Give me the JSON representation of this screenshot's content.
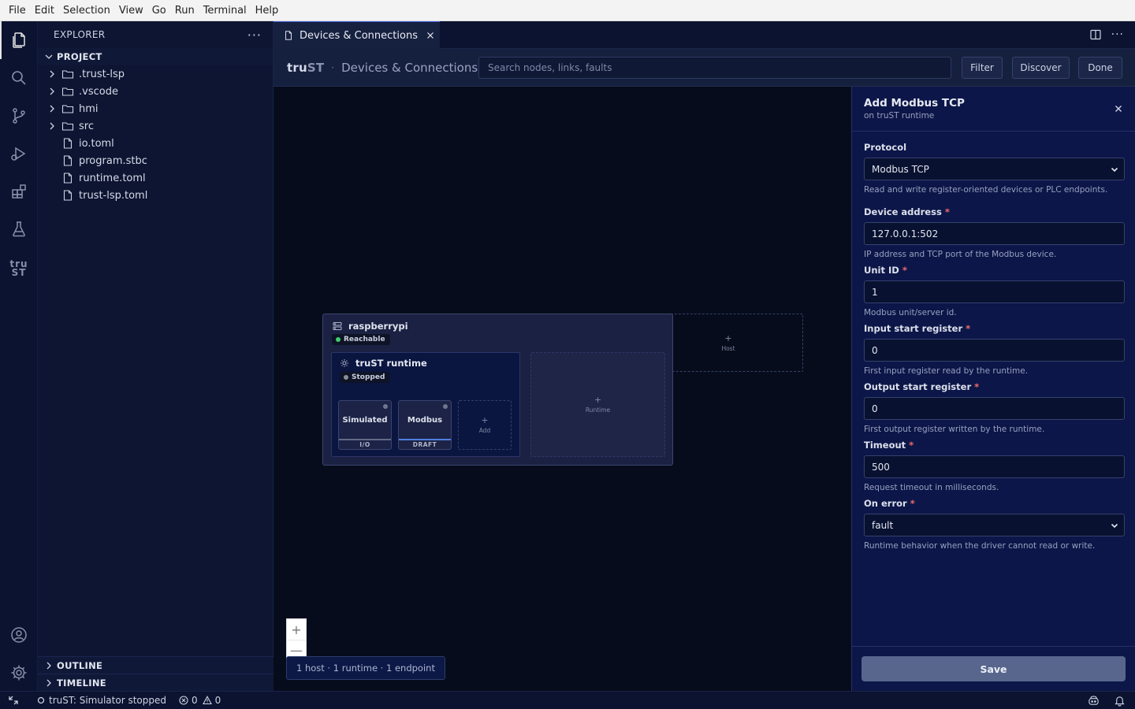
{
  "menu": [
    "File",
    "Edit",
    "Selection",
    "View",
    "Go",
    "Run",
    "Terminal",
    "Help"
  ],
  "activity": {
    "trust_logo_top": "tru",
    "trust_logo_bottom": "ST"
  },
  "explorer": {
    "title": "EXPLORER",
    "more": "···",
    "section": "PROJECT",
    "folders": [
      ".trust-lsp",
      ".vscode",
      "hmi",
      "src"
    ],
    "files": [
      "io.toml",
      "program.stbc",
      "runtime.toml",
      "trust-lsp.toml"
    ],
    "outline": "OUTLINE",
    "timeline": "TIMELINE"
  },
  "editor": {
    "tab_label": "Devices & Connections",
    "more": "···"
  },
  "webview": {
    "brand_a": "tru",
    "brand_b": "ST",
    "sep": "·",
    "crumb": "Devices & Connections",
    "search_placeholder": "Search nodes, links, faults",
    "filter": "Filter",
    "discover": "Discover",
    "done": "Done"
  },
  "canvas": {
    "host_name": "raspberrypi",
    "host_status": "Reachable",
    "runtime_name": "truST runtime",
    "runtime_status": "Stopped",
    "endpoints": [
      {
        "name": "Simulated",
        "foot": "I/O"
      },
      {
        "name": "Modbus",
        "foot": "DRAFT"
      }
    ],
    "add_endpoint": "Add",
    "add_runtime": "Runtime",
    "add_host": "Host",
    "plus": "+",
    "zoom_in": "+",
    "zoom_out": "—",
    "summary": "1 host · 1 runtime · 1 endpoint"
  },
  "panel": {
    "title": "Add Modbus TCP",
    "subtitle": "on truST runtime",
    "required_mark": "*",
    "protocol": {
      "label": "Protocol",
      "value": "Modbus TCP",
      "help": "Read and write register-oriented devices or PLC endpoints."
    },
    "address": {
      "label": "Device address",
      "value": "127.0.0.1:502",
      "help": "IP address and TCP port of the Modbus device."
    },
    "unit_id": {
      "label": "Unit ID",
      "value": "1",
      "help": "Modbus unit/server id."
    },
    "input_start": {
      "label": "Input start register",
      "value": "0",
      "help": "First input register read by the runtime."
    },
    "output_start": {
      "label": "Output start register",
      "value": "0",
      "help": "First output register written by the runtime."
    },
    "timeout": {
      "label": "Timeout",
      "value": "500",
      "help": "Request timeout in milliseconds."
    },
    "on_error": {
      "label": "On error",
      "value": "fault",
      "help": "Runtime behavior when the driver cannot read or write."
    },
    "save": "Save"
  },
  "status": {
    "simulator": "truST: Simulator stopped",
    "errors": "0",
    "warnings": "0"
  },
  "colors": {
    "reachable": "#3ecf6e",
    "stopped": "#8a8f9e",
    "required": "#f06b6b",
    "accent": "#3d5bd9"
  }
}
